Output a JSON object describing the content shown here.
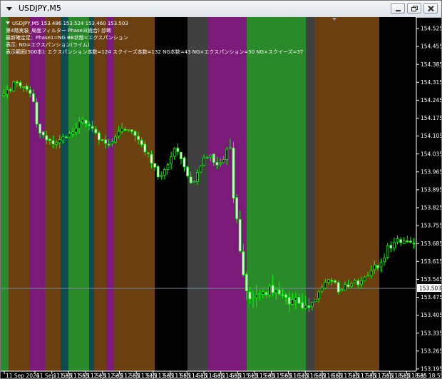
{
  "window": {
    "title": "USDJPY,M5"
  },
  "chart_info": {
    "line1": "USDJPY,M5  153.486 153.524 153.460 153.503",
    "line2": "第4階実装_局面フィルター Phase3(統合) 診断",
    "line3": "最新確定足：Phase1=NG  BB状態=エクスパンション",
    "line4": "表示: NG=エクスパンション(ライム)",
    "line5": "表示範囲(500本): エクスパンション本数=124  スクイーズ本数=132  NG本数=43  NG×エクスパンション=50  NG×スクイーズ=37"
  },
  "price_axis": {
    "labels": [
      "154.525",
      "154.455",
      "154.385",
      "154.315",
      "154.245",
      "154.175",
      "154.105",
      "154.035",
      "153.965",
      "153.895",
      "153.825",
      "153.755",
      "153.685",
      "153.615",
      "153.545",
      "153.475",
      "153.405",
      "153.335",
      "153.265",
      "153.195"
    ],
    "current_price": "153.503"
  },
  "time_axis": {
    "labels": [
      "11 Sep 2026",
      "11 Sep 11:35",
      "11 Sep 11:55",
      "11 Sep 12:15",
      "11 Sep 12:35",
      "11 Sep 12:55",
      "11 Sep 13:15",
      "11 Sep 13:35",
      "11 Sep 13:55",
      "11 Sep 14:15",
      "11 Sep 14:35",
      "11 Sep 14:55",
      "11 Sep 15:15",
      "11 Sep 15:35",
      "11 Sep 15:55",
      "11 Sep 16:15",
      "11 Sep 16:35",
      "11 Sep 16:55",
      "11 Sep 17:15",
      "11 Sep 17:35",
      "11 Sep 17:55",
      "11 Sep 18:15",
      "11 Sep 18:35",
      "11 Sep 18:55"
    ]
  },
  "colors": {
    "background": "#000000",
    "candle": "#00ff00",
    "zone_expansion": "#2a8a2a",
    "zone_squeeze": "#7b1a78",
    "zone_brown": "#6b3f10",
    "zone_teal": "#0d4a52",
    "zone_gray": "#404040",
    "priceline": "#7a8a98"
  }
}
